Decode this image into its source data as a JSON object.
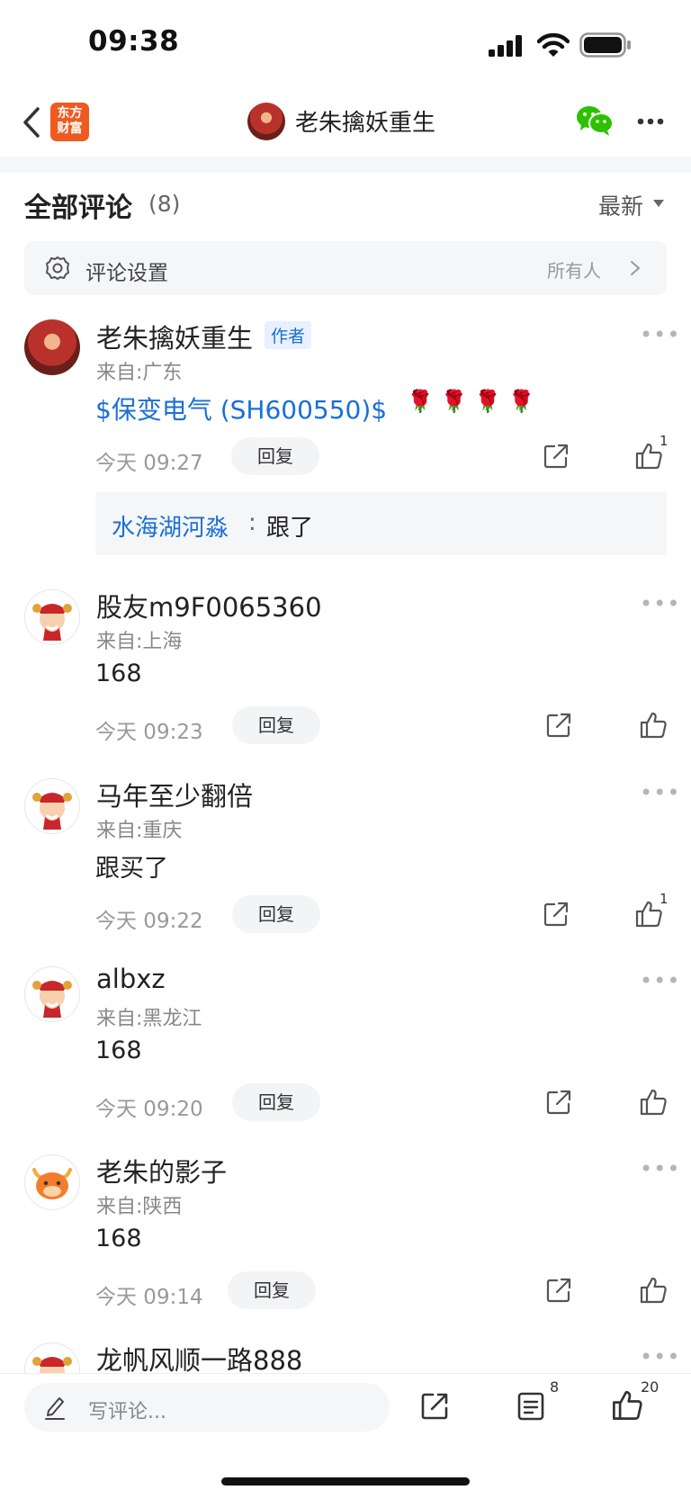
{
  "status": {
    "time": "09:38"
  },
  "header": {
    "logo_line1": "东方",
    "logo_line2": "财富",
    "title": "老朱擒妖重生"
  },
  "comments_header": {
    "title": "全部评论",
    "count": "(8)",
    "sort_label": "最新"
  },
  "settings": {
    "label": "评论设置",
    "value": "所有人"
  },
  "comments": [
    {
      "name": "老朱擒妖重生",
      "tag": "作者",
      "location": "来自:广东",
      "stock_link": "$保变电气 (SH600550)$",
      "roses": "🌹 🌹 🌹 🌹",
      "time": "今天 09:27",
      "reply": "回复",
      "likes": "1",
      "sub_reply": {
        "user": "水海湖河淼",
        "colon": ":",
        "text": "跟了"
      }
    },
    {
      "name": "股友m9F0065360",
      "location": "来自:上海",
      "content": "168",
      "time": "今天 09:23",
      "reply": "回复"
    },
    {
      "name": "马年至少翻倍",
      "location": "来自:重庆",
      "content": "跟买了",
      "time": "今天 09:22",
      "reply": "回复",
      "likes": "1"
    },
    {
      "name": "albxz",
      "location": "来自:黑龙江",
      "content": "168",
      "time": "今天 09:20",
      "reply": "回复"
    },
    {
      "name": "老朱的影子",
      "location": "来自:陕西",
      "content": "168",
      "time": "今天 09:14",
      "reply": "回复"
    },
    {
      "name": "龙帆风顺一路888"
    }
  ],
  "bottom": {
    "write_placeholder": "写评论...",
    "comment_count": "8",
    "like_count": "20"
  },
  "colors": {
    "link_blue": "#1a6fd6",
    "brand_orange": "#ef5a22",
    "wechat_green": "#2dc100"
  },
  "icons": [
    "back-arrow-icon",
    "signal-icon",
    "wifi-icon",
    "battery-icon",
    "wechat-icon",
    "more-icon",
    "gear-icon",
    "chevron-right-icon",
    "caret-down-icon",
    "share-icon",
    "thumbs-up-icon",
    "pencil-icon",
    "comment-list-icon"
  ]
}
